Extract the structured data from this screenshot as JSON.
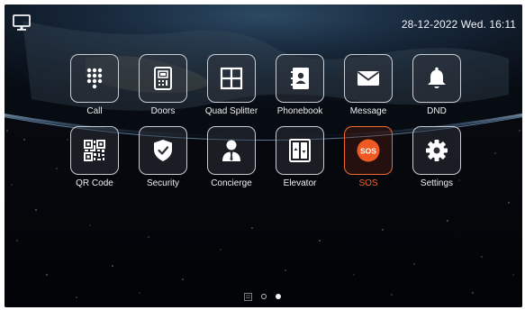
{
  "status_bar": {
    "datetime": "28-12-2022 Wed. 16:11",
    "left_icon": "monitor-icon"
  },
  "apps": [
    {
      "label": "Call",
      "icon": "dialpad-icon"
    },
    {
      "label": "Doors",
      "icon": "door-station-icon"
    },
    {
      "label": "Quad Splitter",
      "icon": "quad-splitter-icon"
    },
    {
      "label": "Phonebook",
      "icon": "phonebook-icon"
    },
    {
      "label": "Message",
      "icon": "envelope-icon"
    },
    {
      "label": "DND",
      "icon": "bell-icon"
    },
    {
      "label": "QR Code",
      "icon": "qr-code-icon"
    },
    {
      "label": "Security",
      "icon": "shield-check-icon"
    },
    {
      "label": "Concierge",
      "icon": "concierge-person-icon"
    },
    {
      "label": "Elevator",
      "icon": "elevator-icon"
    },
    {
      "label": "SOS",
      "icon": "sos-icon",
      "active": true
    },
    {
      "label": "Settings",
      "icon": "gear-icon"
    }
  ],
  "pager": {
    "pages": 2,
    "current_page": 2
  },
  "colors": {
    "accent": "#ef6a2c",
    "text": "#eef0f3",
    "tile_border": "#e1e4eb"
  }
}
